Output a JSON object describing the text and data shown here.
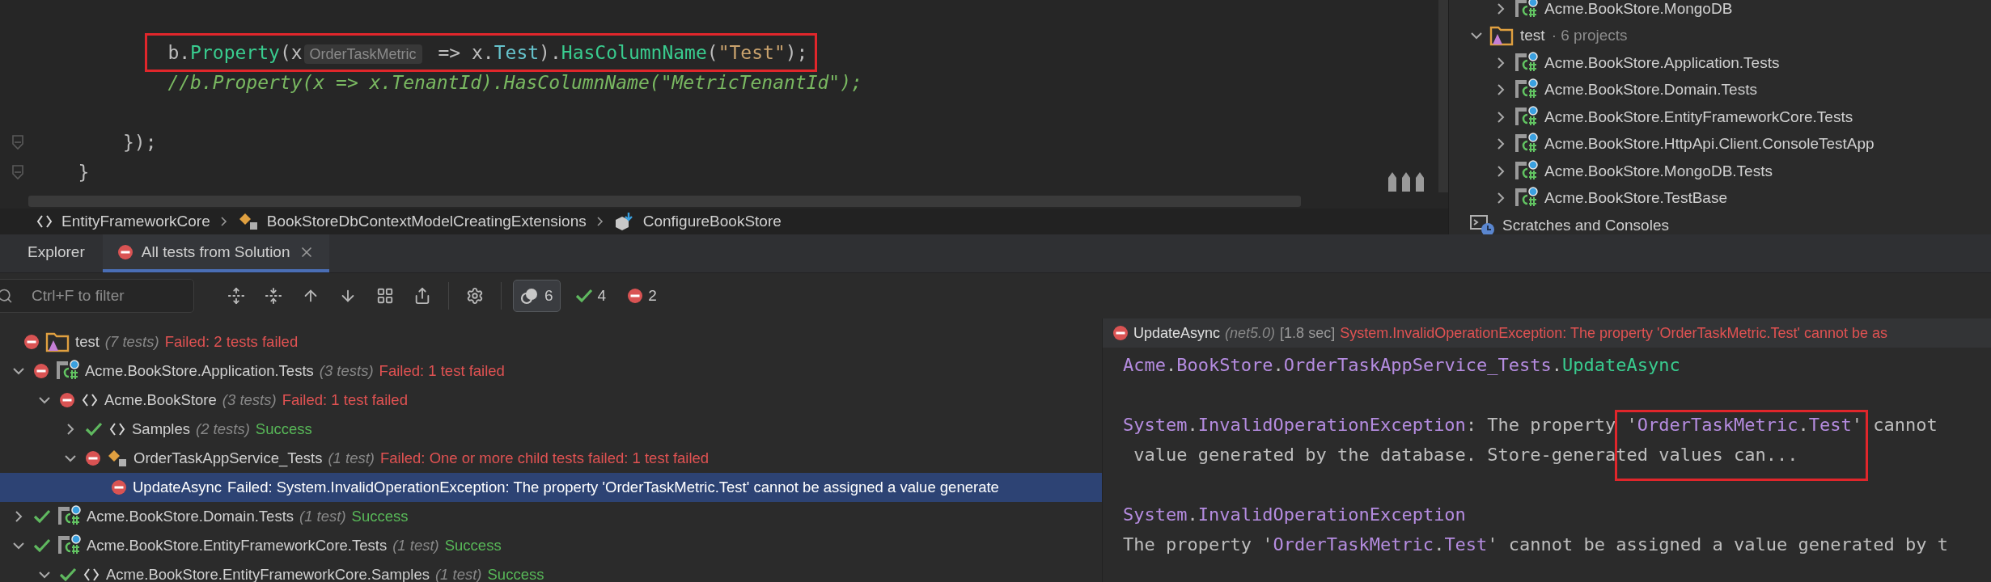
{
  "editor": {
    "lines": [
      {
        "kind": "block",
        "children": [
          {
            "kind": "block",
            "children": [
              {
                "kind": "code",
                "boxed": true,
                "tokens": [
                  {
                    "text": "b.",
                    "kind": "plain"
                  },
                  {
                    "text": "Property",
                    "kind": "method"
                  },
                  {
                    "text": "(x",
                    "kind": "plain"
                  },
                  {
                    "text": "OrderTaskMetric",
                    "kind": "hint"
                  },
                  {
                    "text": " => x.",
                    "kind": "plain"
                  },
                  {
                    "text": "Test",
                    "kind": "field"
                  },
                  {
                    "text": ").",
                    "kind": "plain"
                  },
                  {
                    "text": "HasColumnName",
                    "kind": "method"
                  },
                  {
                    "text": "(",
                    "kind": "plain"
                  },
                  {
                    "text": "\"Test\"",
                    "kind": "string"
                  },
                  {
                    "text": ");",
                    "kind": "plain"
                  }
                ]
              },
              {
                "kind": "code",
                "tokens": [
                  {
                    "text": "//b.Property(x => x.TenantId).HasColumnName(\"MetricTenantId\");",
                    "kind": "comment"
                  }
                ]
              },
              {
                "kind": "blank"
              }
            ]
          },
          {
            "kind": "code",
            "foldable": true,
            "tokens": [
              {
                "text": "});",
                "kind": "plain"
              }
            ]
          }
        ]
      },
      {
        "kind": "code",
        "foldable": true,
        "tokens": [
          {
            "text": "}",
            "kind": "plain"
          }
        ]
      }
    ]
  },
  "breadcrumbs": [
    {
      "label": "EntityFrameworkCore",
      "kind": "namespace"
    },
    {
      "label": "BookStoreDbContextModelCreatingExtensions",
      "kind": "class"
    },
    {
      "label": "ConfigureBookStore",
      "kind": "method"
    }
  ],
  "solution": {
    "tail_items": [
      {
        "label": "Acme.BookStore.MongoDB",
        "kind": "project",
        "expanded": false
      }
    ],
    "items": [
      {
        "label": "test",
        "count": "· 6 projects",
        "kind": "folder",
        "expanded": true,
        "children": [
          {
            "label": "Acme.BookStore.Application.Tests",
            "kind": "project",
            "expanded": false
          },
          {
            "label": "Acme.BookStore.Domain.Tests",
            "kind": "project",
            "expanded": false
          },
          {
            "label": "Acme.BookStore.EntityFrameworkCore.Tests",
            "kind": "project",
            "expanded": false
          },
          {
            "label": "Acme.BookStore.HttpApi.Client.ConsoleTestApp",
            "kind": "project",
            "expanded": false
          },
          {
            "label": "Acme.BookStore.MongoDB.Tests",
            "kind": "project",
            "expanded": false
          },
          {
            "label": "Acme.BookStore.TestBase",
            "kind": "project",
            "expanded": false
          }
        ]
      },
      {
        "label": "Scratches and Consoles",
        "kind": "console"
      }
    ]
  },
  "tabs": [
    {
      "label": "Explorer",
      "selected": false
    },
    {
      "label": "All tests from Solution",
      "selected": true,
      "failed": true,
      "closable": true
    }
  ],
  "toolbar": {
    "search": {
      "placeholder": "Ctrl+F to filter"
    },
    "tools": [
      {
        "kind": "expand"
      },
      {
        "kind": "collapse"
      },
      {
        "kind": "previous"
      },
      {
        "kind": "next"
      },
      {
        "kind": "group"
      },
      {
        "kind": "export"
      },
      {
        "kind": "settings"
      }
    ],
    "counters": [
      {
        "kind": "total",
        "count": "6",
        "selected": true
      },
      {
        "kind": "passed",
        "count": "4",
        "selected": false
      },
      {
        "kind": "failed",
        "count": "2",
        "selected": false
      }
    ]
  },
  "tests": [
    {
      "name": "test",
      "kind": "folder",
      "count": "(7 tests)",
      "failed": true,
      "result": "Failed: 2 tests failed",
      "selected": false,
      "children": [
        {
          "name": "Acme.BookStore.Application.Tests",
          "kind": "project",
          "count": "(3 tests)",
          "failed": true,
          "result": "Failed: 1 test failed",
          "expanded": true,
          "selected": false,
          "children": [
            {
              "name": "Acme.BookStore",
              "kind": "namespace",
              "count": "(3 tests)",
              "failed": true,
              "result": "Failed: 1 test failed",
              "expanded": true,
              "selected": false,
              "children": [
                {
                  "name": "Samples",
                  "kind": "namespace",
                  "count": "(2 tests)",
                  "failed": false,
                  "result": "Success",
                  "expanded": false,
                  "selected": false
                },
                {
                  "name": "OrderTaskAppService_Tests",
                  "kind": "class",
                  "count": "(1 test)",
                  "failed": true,
                  "result": "Failed: One or more child tests failed: 1 test failed",
                  "expanded": true,
                  "selected": false,
                  "children": [
                    {
                      "name": "UpdateAsync",
                      "failed": true,
                      "result": "Failed: System.InvalidOperationException: The property 'OrderTaskMetric.Test' cannot be assigned a value generate",
                      "selected": true
                    }
                  ]
                }
              ]
            }
          ]
        },
        {
          "name": "Acme.BookStore.Domain.Tests",
          "kind": "project",
          "count": "(1 test)",
          "failed": false,
          "result": "Success",
          "expanded": false,
          "selected": false
        },
        {
          "name": "Acme.BookStore.EntityFrameworkCore.Tests",
          "kind": "project",
          "count": "(1 test)",
          "failed": false,
          "result": "Success",
          "expanded": true,
          "selected": false,
          "children": [
            {
              "name": "Acme.BookStore.EntityFrameworkCore.Samples",
              "kind": "namespace",
              "count": "(1 test)",
              "failed": false,
              "result": "Success",
              "expanded": true,
              "selected": false
            }
          ]
        }
      ]
    }
  ],
  "output": {
    "header": {
      "failed": true,
      "name": "UpdateAsync",
      "framework": "(net5.0)",
      "duration": "[1.8 sec]",
      "message": "System.InvalidOperationException: The property 'OrderTaskMetric.Test' cannot be as"
    },
    "paragraphs": [
      {
        "lines": [
          {
            "tokens": [
              {
                "text": "Acme",
                "kind": "type"
              },
              {
                "text": ".",
                "kind": "plain"
              },
              {
                "text": "BookStore",
                "kind": "type"
              },
              {
                "text": ".",
                "kind": "plain"
              },
              {
                "text": "OrderTaskAppService_Tests",
                "kind": "type"
              },
              {
                "text": ".",
                "kind": "plain"
              },
              {
                "text": "UpdateAsync",
                "kind": "method"
              }
            ]
          }
        ]
      },
      {
        "lines": [
          {
            "tokens": [
              {
                "text": "System",
                "kind": "type"
              },
              {
                "text": ".",
                "kind": "plain"
              },
              {
                "text": "InvalidOperationException",
                "kind": "type"
              },
              {
                "text": ": The property ",
                "kind": "plain"
              },
              {
                "text": "'",
                "kind": "plain",
                "boxed": true
              },
              {
                "text": "OrderTaskMetric",
                "kind": "type",
                "boxed": true
              },
              {
                "text": ".",
                "kind": "plain",
                "boxed": true
              },
              {
                "text": "Test",
                "kind": "type",
                "boxed": true
              },
              {
                "text": "'",
                "kind": "plain",
                "boxed": true
              },
              {
                "text": " cannot",
                "kind": "plain"
              }
            ]
          },
          {
            "tokens": [
              {
                "text": " value generated by the database. Store-generated values can...",
                "kind": "plain"
              }
            ]
          }
        ]
      },
      {
        "lines": [
          {
            "tokens": [
              {
                "text": "System",
                "kind": "type"
              },
              {
                "text": ".",
                "kind": "plain"
              },
              {
                "text": "InvalidOperationException",
                "kind": "type"
              }
            ]
          },
          {
            "tokens": [
              {
                "text": "The property '",
                "kind": "plain"
              },
              {
                "text": "OrderTaskMetric",
                "kind": "type"
              },
              {
                "text": ".",
                "kind": "plain"
              },
              {
                "text": "Test",
                "kind": "type"
              },
              {
                "text": "' cannot be assigned a value generated by t",
                "kind": "plain"
              }
            ]
          }
        ]
      }
    ]
  }
}
